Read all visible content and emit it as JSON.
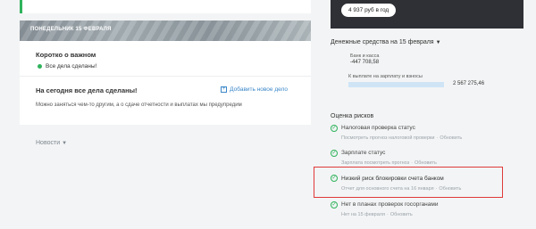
{
  "feed": {
    "banner_date": "ПОНЕДЕЛЬНИК 15 ФЕВРАЛЯ",
    "brief_title": "Коротко о важном",
    "brief_status": "Все дела сделаны!",
    "today_title": "На сегодня все дела сделаны!",
    "add_task_label": "Добавить новое дело",
    "today_sub": "Можно заняться чем-то другим, а о сдаче отчетности и выплатах мы предупредим",
    "news_label": "Новости"
  },
  "right": {
    "price_pill": "4 937 руб в год",
    "cash_title": "Денежные средства на 15 февраля",
    "bank_label": "Банк и касса",
    "bank_value": "-447 708,58",
    "pay_label": "К выплате на зарплату и взносы",
    "pay_value": "2 567 275,46",
    "pay_bar_fill": 1.0
  },
  "risks": {
    "title": "Оценка рисков",
    "items": [
      {
        "name": "Налоговая проверка статус",
        "link": "Посмотреть прогноз налоговой проверки",
        "action": "Обновить",
        "status": "ok"
      },
      {
        "name": "Зарплате статус",
        "link": "Зарплата посмотреть прогноз",
        "action": "Обновить",
        "status": "ok"
      },
      {
        "name": "Низкий риск блокировки счета банком",
        "link": "Отчет для основного счета на 16 января",
        "action": "Обновить",
        "status": "ok"
      },
      {
        "name": "Нет в планах проверок госорганами",
        "link": "Нет на 15 февраля",
        "action": "Обновить",
        "status": "ok"
      }
    ]
  },
  "colors": {
    "accent": "#3b87c8",
    "ok": "#2fb35c",
    "highlight": "#e03a3a",
    "dark": "#2e3036"
  },
  "icons": {
    "ok": "check-circle-icon",
    "add": "plus-box-icon",
    "chevron": "chevron-down-icon"
  }
}
